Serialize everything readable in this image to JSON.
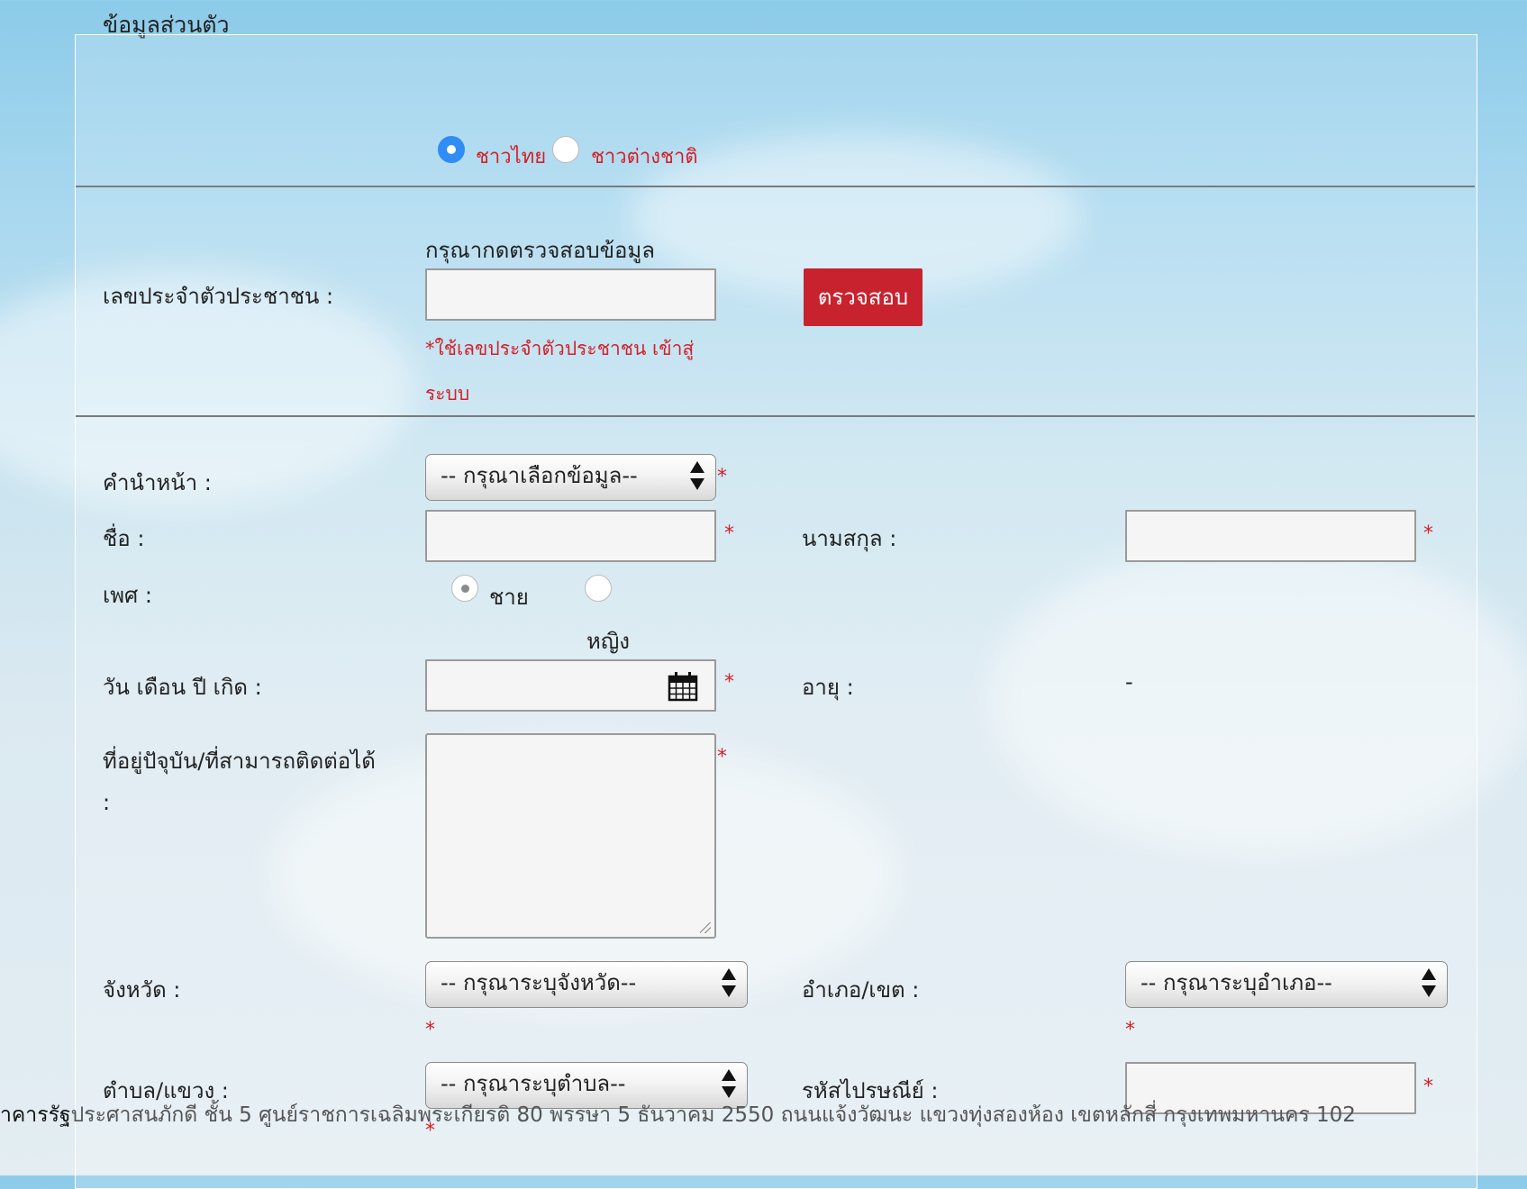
{
  "section": {
    "title": "ข้อมูลส่วนตัว"
  },
  "nationality": {
    "thai_label": "ชาวไทย",
    "foreign_label": "ชาวต่างชาติ",
    "selected": "thai"
  },
  "idcheck": {
    "hint": "กรุณากดตรวจสอบข้อมูล",
    "label": "เลขประจำตัวประชาชน :",
    "value": "",
    "button": "ตรวจสอบ",
    "note_line1": "*ใช้เลขประจำตัวประชาชน เข้าสู่",
    "note_line2": "ระบบ"
  },
  "form": {
    "prefix_label": "คำนำหน้า :",
    "prefix_value": "-- กรุณาเลือกข้อมูล--",
    "firstname_label": "ชื่อ :",
    "lastname_label": "นามสกุล :",
    "gender_label": "เพศ :",
    "gender_male": "ชาย",
    "gender_female": "หญิง",
    "dob_label": "วัน เดือน ปี เกิด :",
    "age_label": "อายุ :",
    "age_value": "-",
    "address_label_line1": "ที่อยู่ปัจุบัน/ที่สามารถติดต่อได้",
    "address_label_line2": ":",
    "province_label": "จังหวัด :",
    "province_value": "-- กรุณาระบุจังหวัด--",
    "district_label": "อำเภอ/เขต :",
    "district_value": "-- กรุณาระบุอำเภอ--",
    "subdistrict_label": "ตำบล/แขวง :",
    "subdistrict_value": "-- กรุณาระบุตำบล--",
    "postcode_label": "รหัสไปรษณีย์ :",
    "required_mark": "*"
  },
  "footer": {
    "lead": "าคารรัฐ",
    "text": "ประศาสนภักดี ชั้น 5 ศูนย์ราชการเฉลิมพระเกียรติ 80 พรรษา 5 ธันวาคม 2550 ถนนแจ้งวัฒนะ แขวงทุ่งสองห้อง เขตหลักสี่ กรุงเทพมหานคร 102"
  },
  "colors": {
    "accent_red": "#c8222f",
    "radio_blue": "#2f8df5"
  }
}
